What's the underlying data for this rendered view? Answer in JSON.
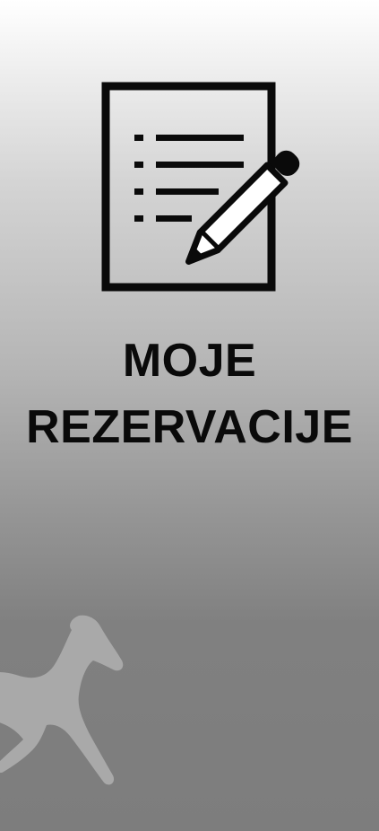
{
  "tile": {
    "title_line_1": "MOJE",
    "title_line_2": "REZERVACIJE",
    "icon": "document-edit-icon",
    "watermark_icon": "horse-icon"
  },
  "colors": {
    "gradient_top": "#ffffff",
    "gradient_bottom": "#7d7d7d",
    "title": "#0a0a0a",
    "icon_stroke": "#0a0a0a",
    "watermark": "#a9a9a9"
  }
}
